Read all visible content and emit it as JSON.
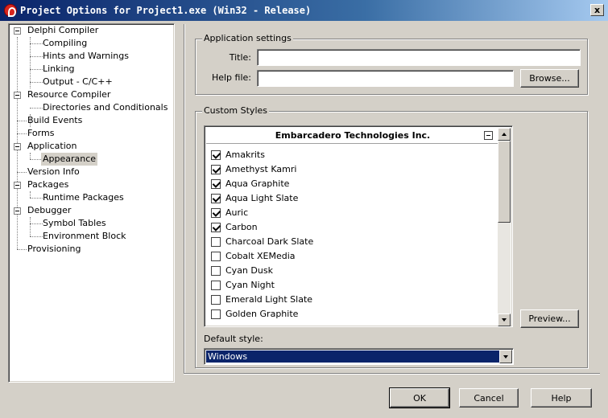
{
  "window": {
    "title": "Project Options for Project1.exe  (Win32 - Release)",
    "close_label": "x"
  },
  "tree": {
    "items": [
      {
        "label": "Delphi Compiler",
        "level": 0,
        "expanded": true
      },
      {
        "label": "Compiling",
        "level": 1
      },
      {
        "label": "Hints and Warnings",
        "level": 1
      },
      {
        "label": "Linking",
        "level": 1
      },
      {
        "label": "Output - C/C++",
        "level": 1
      },
      {
        "label": "Resource Compiler",
        "level": 0,
        "expanded": true
      },
      {
        "label": "Directories and Conditionals",
        "level": 1
      },
      {
        "label": "Build Events",
        "level": 0
      },
      {
        "label": "Forms",
        "level": 0
      },
      {
        "label": "Application",
        "level": 0,
        "expanded": true
      },
      {
        "label": "Appearance",
        "level": 1,
        "selected": true
      },
      {
        "label": "Version Info",
        "level": 0
      },
      {
        "label": "Packages",
        "level": 0,
        "expanded": true
      },
      {
        "label": "Runtime Packages",
        "level": 1
      },
      {
        "label": "Debugger",
        "level": 0,
        "expanded": true
      },
      {
        "label": "Symbol Tables",
        "level": 1
      },
      {
        "label": "Environment Block",
        "level": 1
      },
      {
        "label": "Provisioning",
        "level": 0
      }
    ]
  },
  "app_settings": {
    "group_label": "Application settings",
    "title_label": "Title:",
    "title_value": "",
    "helpfile_label": "Help file:",
    "helpfile_value": "",
    "browse_label": "Browse..."
  },
  "custom_styles": {
    "group_label": "Custom Styles",
    "header": "Embarcadero Technologies Inc.",
    "styles": [
      {
        "name": "Amakrits",
        "checked": true
      },
      {
        "name": "Amethyst Kamri",
        "checked": true
      },
      {
        "name": "Aqua Graphite",
        "checked": true
      },
      {
        "name": "Aqua Light Slate",
        "checked": true
      },
      {
        "name": "Auric",
        "checked": true
      },
      {
        "name": "Carbon",
        "checked": true
      },
      {
        "name": "Charcoal Dark Slate",
        "checked": false
      },
      {
        "name": "Cobalt XEMedia",
        "checked": false
      },
      {
        "name": "Cyan Dusk",
        "checked": false
      },
      {
        "name": "Cyan Night",
        "checked": false
      },
      {
        "name": "Emerald Light Slate",
        "checked": false
      },
      {
        "name": "Golden Graphite",
        "checked": false
      }
    ],
    "preview_label": "Preview...",
    "default_style_label": "Default style:",
    "default_style_value": "Windows"
  },
  "footer": {
    "ok_label": "OK",
    "cancel_label": "Cancel",
    "help_label": "Help"
  }
}
